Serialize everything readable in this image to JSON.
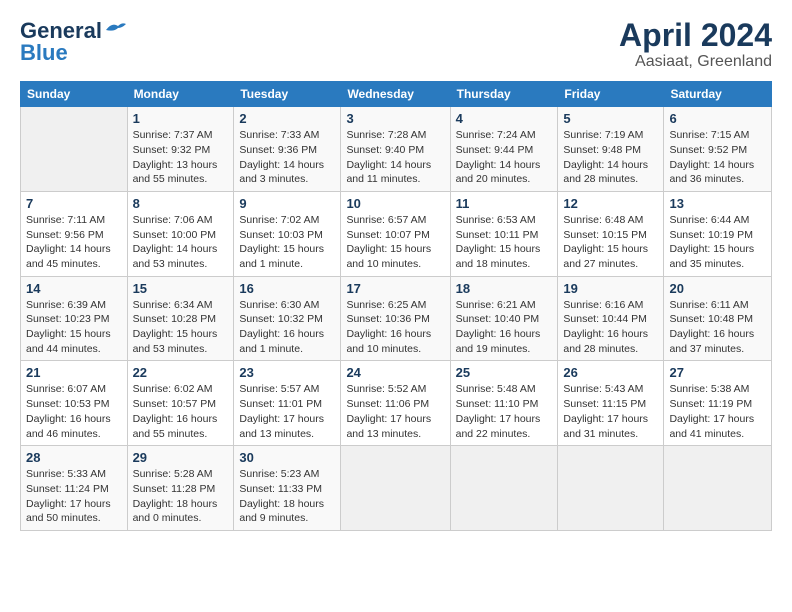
{
  "header": {
    "logo_line1": "General",
    "logo_line2": "Blue",
    "title": "April 2024",
    "subtitle": "Aasiaat, Greenland"
  },
  "days_of_week": [
    "Sunday",
    "Monday",
    "Tuesday",
    "Wednesday",
    "Thursday",
    "Friday",
    "Saturday"
  ],
  "weeks": [
    [
      {
        "day": "",
        "info": ""
      },
      {
        "day": "1",
        "info": "Sunrise: 7:37 AM\nSunset: 9:32 PM\nDaylight: 13 hours\nand 55 minutes."
      },
      {
        "day": "2",
        "info": "Sunrise: 7:33 AM\nSunset: 9:36 PM\nDaylight: 14 hours\nand 3 minutes."
      },
      {
        "day": "3",
        "info": "Sunrise: 7:28 AM\nSunset: 9:40 PM\nDaylight: 14 hours\nand 11 minutes."
      },
      {
        "day": "4",
        "info": "Sunrise: 7:24 AM\nSunset: 9:44 PM\nDaylight: 14 hours\nand 20 minutes."
      },
      {
        "day": "5",
        "info": "Sunrise: 7:19 AM\nSunset: 9:48 PM\nDaylight: 14 hours\nand 28 minutes."
      },
      {
        "day": "6",
        "info": "Sunrise: 7:15 AM\nSunset: 9:52 PM\nDaylight: 14 hours\nand 36 minutes."
      }
    ],
    [
      {
        "day": "7",
        "info": "Sunrise: 7:11 AM\nSunset: 9:56 PM\nDaylight: 14 hours\nand 45 minutes."
      },
      {
        "day": "8",
        "info": "Sunrise: 7:06 AM\nSunset: 10:00 PM\nDaylight: 14 hours\nand 53 minutes."
      },
      {
        "day": "9",
        "info": "Sunrise: 7:02 AM\nSunset: 10:03 PM\nDaylight: 15 hours\nand 1 minute."
      },
      {
        "day": "10",
        "info": "Sunrise: 6:57 AM\nSunset: 10:07 PM\nDaylight: 15 hours\nand 10 minutes."
      },
      {
        "day": "11",
        "info": "Sunrise: 6:53 AM\nSunset: 10:11 PM\nDaylight: 15 hours\nand 18 minutes."
      },
      {
        "day": "12",
        "info": "Sunrise: 6:48 AM\nSunset: 10:15 PM\nDaylight: 15 hours\nand 27 minutes."
      },
      {
        "day": "13",
        "info": "Sunrise: 6:44 AM\nSunset: 10:19 PM\nDaylight: 15 hours\nand 35 minutes."
      }
    ],
    [
      {
        "day": "14",
        "info": "Sunrise: 6:39 AM\nSunset: 10:23 PM\nDaylight: 15 hours\nand 44 minutes."
      },
      {
        "day": "15",
        "info": "Sunrise: 6:34 AM\nSunset: 10:28 PM\nDaylight: 15 hours\nand 53 minutes."
      },
      {
        "day": "16",
        "info": "Sunrise: 6:30 AM\nSunset: 10:32 PM\nDaylight: 16 hours\nand 1 minute."
      },
      {
        "day": "17",
        "info": "Sunrise: 6:25 AM\nSunset: 10:36 PM\nDaylight: 16 hours\nand 10 minutes."
      },
      {
        "day": "18",
        "info": "Sunrise: 6:21 AM\nSunset: 10:40 PM\nDaylight: 16 hours\nand 19 minutes."
      },
      {
        "day": "19",
        "info": "Sunrise: 6:16 AM\nSunset: 10:44 PM\nDaylight: 16 hours\nand 28 minutes."
      },
      {
        "day": "20",
        "info": "Sunrise: 6:11 AM\nSunset: 10:48 PM\nDaylight: 16 hours\nand 37 minutes."
      }
    ],
    [
      {
        "day": "21",
        "info": "Sunrise: 6:07 AM\nSunset: 10:53 PM\nDaylight: 16 hours\nand 46 minutes."
      },
      {
        "day": "22",
        "info": "Sunrise: 6:02 AM\nSunset: 10:57 PM\nDaylight: 16 hours\nand 55 minutes."
      },
      {
        "day": "23",
        "info": "Sunrise: 5:57 AM\nSunset: 11:01 PM\nDaylight: 17 hours\nand 13 minutes."
      },
      {
        "day": "24",
        "info": "Sunrise: 5:52 AM\nSunset: 11:06 PM\nDaylight: 17 hours\nand 13 minutes."
      },
      {
        "day": "25",
        "info": "Sunrise: 5:48 AM\nSunset: 11:10 PM\nDaylight: 17 hours\nand 22 minutes."
      },
      {
        "day": "26",
        "info": "Sunrise: 5:43 AM\nSunset: 11:15 PM\nDaylight: 17 hours\nand 31 minutes."
      },
      {
        "day": "27",
        "info": "Sunrise: 5:38 AM\nSunset: 11:19 PM\nDaylight: 17 hours\nand 41 minutes."
      }
    ],
    [
      {
        "day": "28",
        "info": "Sunrise: 5:33 AM\nSunset: 11:24 PM\nDaylight: 17 hours\nand 50 minutes."
      },
      {
        "day": "29",
        "info": "Sunrise: 5:28 AM\nSunset: 11:28 PM\nDaylight: 18 hours\nand 0 minutes."
      },
      {
        "day": "30",
        "info": "Sunrise: 5:23 AM\nSunset: 11:33 PM\nDaylight: 18 hours\nand 9 minutes."
      },
      {
        "day": "",
        "info": ""
      },
      {
        "day": "",
        "info": ""
      },
      {
        "day": "",
        "info": ""
      },
      {
        "day": "",
        "info": ""
      }
    ]
  ]
}
